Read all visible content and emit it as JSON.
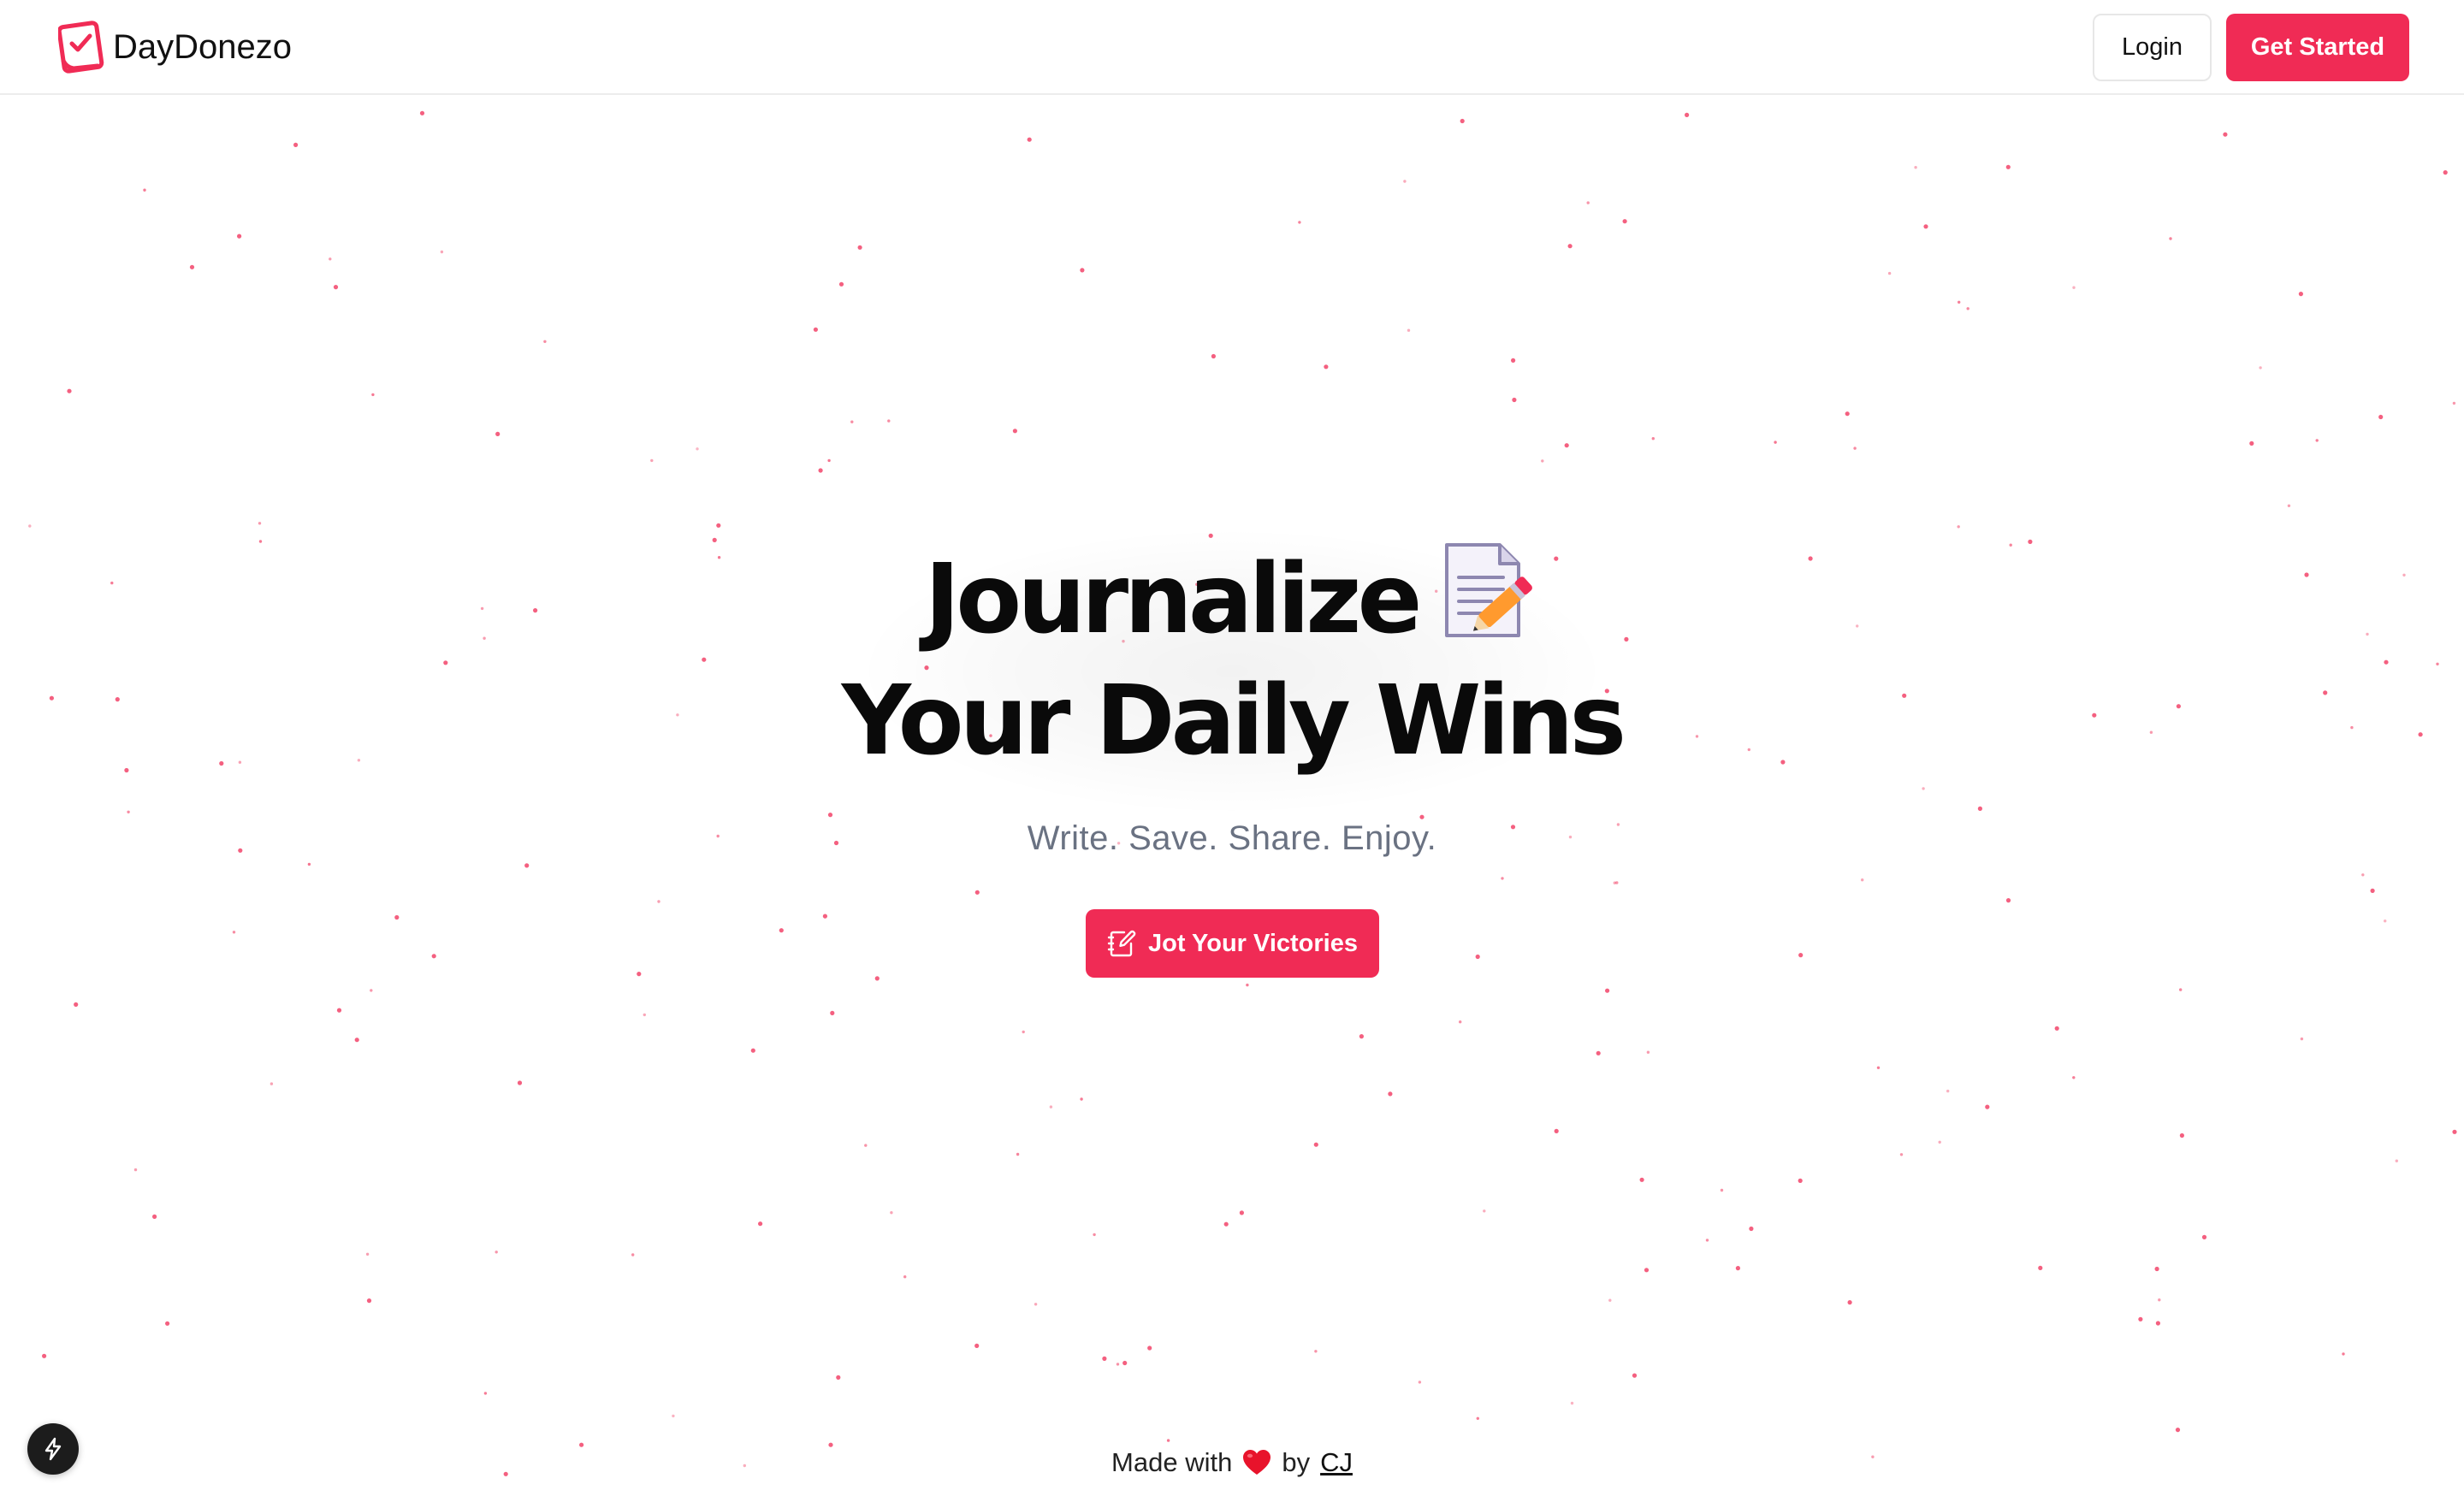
{
  "header": {
    "brand_name": "DayDonezo",
    "login_label": "Login",
    "get_started_label": "Get Started"
  },
  "hero": {
    "title_line1": "Journalize",
    "title_line2": "Your Daily Wins",
    "subtitle": "Write. Save. Share. Enjoy.",
    "cta_label": "Jot Your Victories"
  },
  "footer": {
    "made_with": "Made with",
    "by": "by",
    "author": "CJ"
  },
  "icons": {
    "brand_logo": "journal-check-icon",
    "title_emoji": "memo-pencil-icon",
    "cta_icon": "notebook-pen-icon",
    "footer_heart": "heart-icon",
    "corner_badge": "lightning-bolt-icon"
  },
  "colors": {
    "accent": "#f02b55",
    "dots": "#f02b55",
    "text_primary": "#0a0a0a",
    "text_muted": "#6a7282"
  }
}
